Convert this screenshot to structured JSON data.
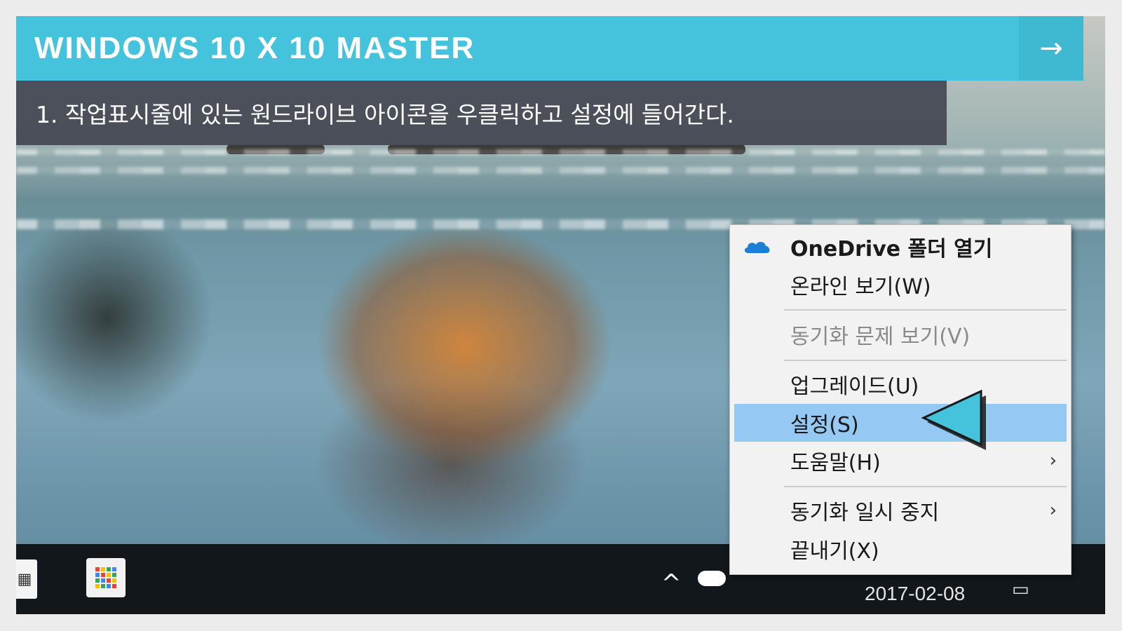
{
  "header": {
    "title": "WINDOWS 10 X 10 MASTER",
    "next_arrow": "→"
  },
  "instruction": {
    "text": "1. 작업표시줄에 있는 원드라이브 아이콘을 우클릭하고 설정에 들어간다."
  },
  "context_menu": {
    "items": [
      {
        "label": "OneDrive 폴더 열기",
        "bold": true,
        "icon": "onedrive-cloud-icon"
      },
      {
        "label": "온라인 보기(W)"
      },
      {
        "label": "동기화 문제 보기(V)",
        "disabled": true
      },
      {
        "label": "업그레이드(U)"
      },
      {
        "label": "설정(S)",
        "selected": true
      },
      {
        "label": "도움말(H)",
        "submenu": true
      },
      {
        "label": "동기화 일시 중지",
        "submenu": true
      },
      {
        "label": "끝내기(X)"
      }
    ],
    "submenu_glyph": "›",
    "selected_color": "#95c9f4"
  },
  "taskbar": {
    "date": "2017-02-08",
    "tray_chevron": "^"
  },
  "colors": {
    "accent": "#45c2dc",
    "instruction_bg": "#464a54",
    "pointer": "#45c2dc"
  }
}
